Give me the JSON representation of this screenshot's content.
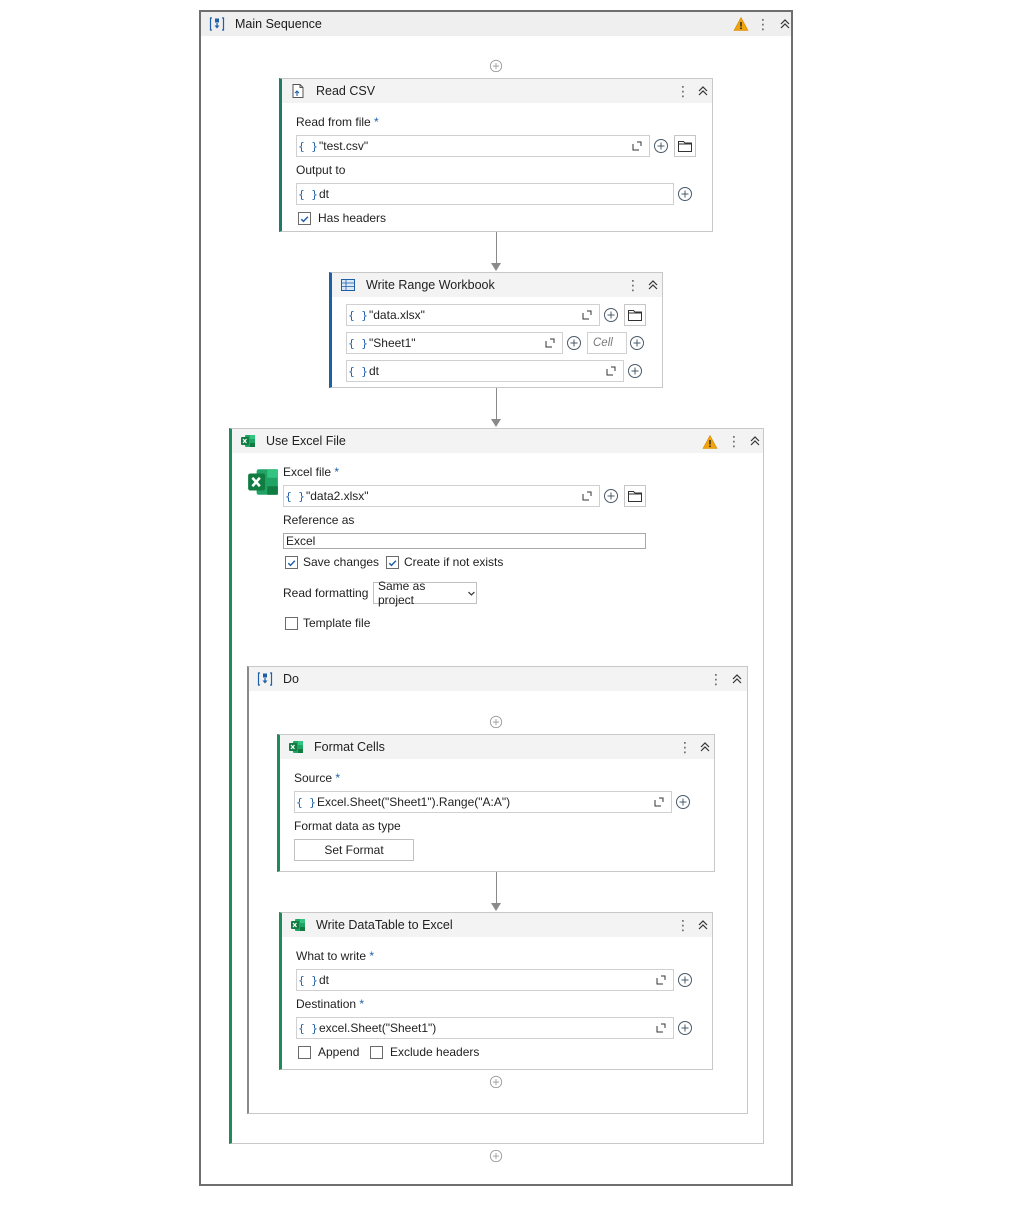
{
  "main_sequence": {
    "title": "Main Sequence"
  },
  "read_csv": {
    "title": "Read CSV",
    "read_from_label": "Read from file",
    "required_mark": "*",
    "read_from_value": "\"test.csv\"",
    "output_label": "Output to",
    "output_value": "dt",
    "has_headers_label": "Has headers",
    "has_headers_checked": true
  },
  "write_range": {
    "title": "Write Range Workbook",
    "file_value": "\"data.xlsx\"",
    "sheet_value": "\"Sheet1\"",
    "cell_placeholder": "Cell",
    "data_value": "dt"
  },
  "use_excel": {
    "title": "Use Excel File",
    "excel_file_label": "Excel file",
    "required_mark": "*",
    "excel_file_value": "\"data2.xlsx\"",
    "reference_label": "Reference as",
    "reference_value": "Excel",
    "save_changes_label": "Save changes",
    "create_label": "Create if not exists",
    "read_formatting_label": "Read formatting",
    "read_formatting_value": "Same as project",
    "template_label": "Template file"
  },
  "do_block": {
    "title": "Do"
  },
  "format_cells": {
    "title": "Format Cells",
    "source_label": "Source",
    "required_mark": "*",
    "source_value": "Excel.Sheet(\"Sheet1\").Range(\"A:A\")",
    "format_label": "Format data as type",
    "set_format_label": "Set Format"
  },
  "write_dt": {
    "title": "Write DataTable to Excel",
    "what_label": "What to write",
    "required_mark": "*",
    "what_value": "dt",
    "dest_label": "Destination",
    "dest_value": "excel.Sheet(\"Sheet1\")",
    "append_label": "Append",
    "exclude_label": "Exclude headers"
  },
  "colors": {
    "accent_blue": "#1f5fa8",
    "excel_green": "#1f8a5b",
    "warning": "#f0a30a"
  }
}
